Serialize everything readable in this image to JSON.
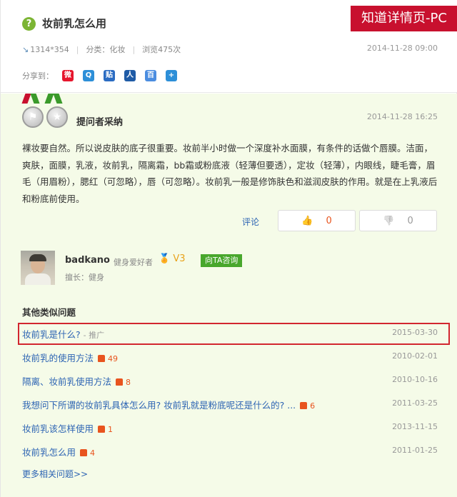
{
  "header": {
    "title": "妆前乳怎么用",
    "badge": "知道详情页-PC",
    "meta": {
      "size": "1314*354",
      "category": "分类：化妆",
      "views": "浏览475次",
      "date": "2014-11-28 09:00"
    },
    "share_label": "分享到：",
    "share_icons": [
      {
        "name": "weibo",
        "color": "#e6162d"
      },
      {
        "name": "qzone",
        "color": "#2d8fd8"
      },
      {
        "name": "tieba",
        "color": "#2b6cc2"
      },
      {
        "name": "renren",
        "color": "#1f5ba6"
      },
      {
        "name": "baidu-space",
        "color": "#4b8de0"
      },
      {
        "name": "more",
        "color": "#2d8fd8"
      }
    ]
  },
  "answer": {
    "adopt_label": "提问者采纳",
    "date": "2014-11-28 16:25",
    "text": "裸妆要自然。所以说皮肤的底子很重要。妆前半小时做一个深度补水面膜，有条件的话做个唇膜。洁面，爽肤，面膜，乳液，妆前乳，隔离霜，bb霜或粉底液（轻薄但要透），定妆（轻薄），内眼线，睫毛膏，眉毛（用眉粉），腮红（可忽略），唇（可忽略）。妆前乳一般是修饰肤色和滋润皮肤的作用。就是在上乳液后和粉底前使用。",
    "comment_label": "评论",
    "up_count": "0",
    "down_count": "0",
    "user": {
      "name": "badkano",
      "title": "健身爱好者",
      "level": "V3",
      "consult_label": "向TA咨询",
      "specialty": "擅长：健身"
    }
  },
  "similar": {
    "title": "其他类似问题",
    "items": [
      {
        "text": "妆前乳是什么?",
        "promo": "- 推广",
        "likes": "",
        "date": "2015-03-30"
      },
      {
        "text": "妆前乳的使用方法",
        "promo": "",
        "likes": "49",
        "date": "2010-02-01"
      },
      {
        "text": "隔离、妆前乳使用方法",
        "promo": "",
        "likes": "8",
        "date": "2010-10-16"
      },
      {
        "text": "我想问下所谓的妆前乳具体怎么用? 妆前乳就是粉底呢还是什么的? ...",
        "promo": "",
        "likes": "6",
        "date": "2011-03-25"
      },
      {
        "text": "妆前乳该怎样使用",
        "promo": "",
        "likes": "1",
        "date": "2013-11-15"
      },
      {
        "text": "妆前乳怎么用",
        "promo": "",
        "likes": "4",
        "date": "2011-01-25"
      }
    ],
    "more_label": "更多相关问题>>"
  }
}
